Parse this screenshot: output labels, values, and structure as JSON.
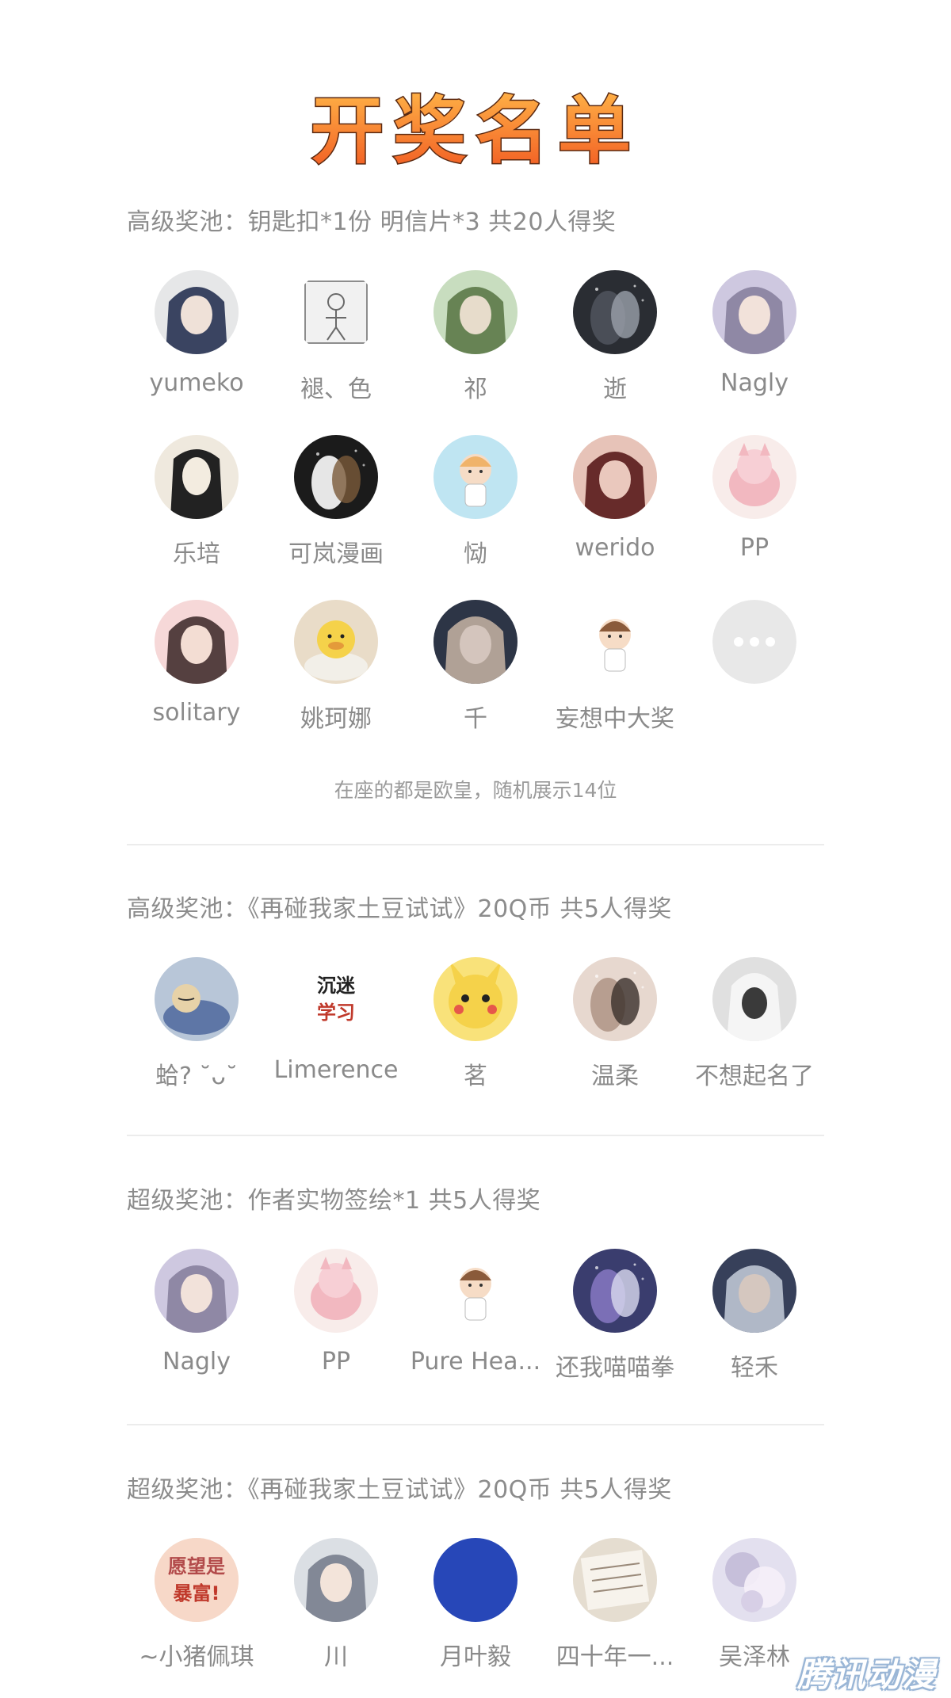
{
  "banner": {
    "title": "开奖名单"
  },
  "note": "在座的都是欧皇，随机展示14位",
  "watermark": "腾讯动漫",
  "sections": [
    {
      "title": "高级奖池：钥匙扣*1份 明信片*3 共20人得奖",
      "winners": [
        {
          "name": "yumeko",
          "avatar": "girl-white-hair-avatar"
        },
        {
          "name": "褪、色",
          "avatar": "sketch-figure-avatar"
        },
        {
          "name": "祁",
          "avatar": "anime-green-hair-avatar"
        },
        {
          "name": "逝",
          "avatar": "dark-figure-avatar"
        },
        {
          "name": "Nagly",
          "avatar": "girl-lavender-avatar"
        },
        {
          "name": "乐培",
          "avatar": "ink-girl-avatar"
        },
        {
          "name": "可岚漫画",
          "avatar": "dark-splash-avatar"
        },
        {
          "name": "恸",
          "avatar": "cute-chibi-avatar"
        },
        {
          "name": "werido",
          "avatar": "red-dress-girl-avatar"
        },
        {
          "name": "PP",
          "avatar": "pink-pig-avatar"
        },
        {
          "name": "solitary",
          "avatar": "pink-girl-avatar"
        },
        {
          "name": "姚珂娜",
          "avatar": "yellow-duck-avatar"
        },
        {
          "name": "千",
          "avatar": "dark-hair-boy-avatar"
        },
        {
          "name": "妄想中大奖",
          "avatar": "chibi-boy-avatar"
        },
        {
          "name": "",
          "avatar": "more-icon"
        }
      ]
    },
    {
      "title": "高级奖池：《再碰我家土豆试试》20Q币 共5人得奖",
      "winners": [
        {
          "name": "蛤? ˘ᴗ˘",
          "avatar": "sleeping-blue-avatar"
        },
        {
          "name": "Limerence",
          "avatar": "text-study-avatar",
          "avatar_text": [
            "沉迷",
            "学习"
          ]
        },
        {
          "name": "茗",
          "avatar": "pikachu-avatar"
        },
        {
          "name": "温柔",
          "avatar": "couple-photo-avatar"
        },
        {
          "name": "不想起名了",
          "avatar": "hooded-figure-avatar"
        }
      ]
    },
    {
      "title": "超级奖池：作者实物签绘*1 共5人得奖",
      "winners": [
        {
          "name": "Nagly",
          "avatar": "girl-lavender-avatar"
        },
        {
          "name": "PP",
          "avatar": "pink-pig-avatar"
        },
        {
          "name": "Pure Hea...",
          "avatar": "chibi-boy-avatar"
        },
        {
          "name": "还我喵喵拳",
          "avatar": "purple-couple-avatar"
        },
        {
          "name": "轻禾",
          "avatar": "dark-hair-girl-avatar"
        }
      ]
    },
    {
      "title": "超级奖池：《再碰我家土豆试试》20Q币 共5人得奖",
      "winners": [
        {
          "name": "~小猪佩琪",
          "avatar": "baby-sticker-avatar",
          "avatar_text": [
            "愿望是",
            "暴富!"
          ]
        },
        {
          "name": "川",
          "avatar": "white-hair-boy-avatar"
        },
        {
          "name": "月叶毅",
          "avatar": "blue-hair-anime-avatar"
        },
        {
          "name": "四十年一...",
          "avatar": "notebook-avatar"
        },
        {
          "name": "吴泽林",
          "avatar": "pastel-art-avatar"
        }
      ]
    }
  ]
}
